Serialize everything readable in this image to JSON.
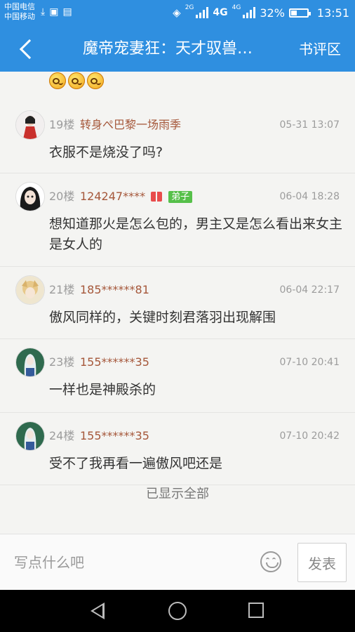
{
  "status_bar": {
    "carrier1": "中国电信",
    "carrier2": "中国移动",
    "net1": "2G",
    "net2": "4G",
    "net3": "4G",
    "battery_pct": "32%",
    "battery_fraction": 0.32,
    "time": "13:51",
    "icons": [
      "download-icon",
      "image-icon",
      "keyboard-icon",
      "vibrate-icon",
      "signal-icon",
      "battery-icon"
    ]
  },
  "header": {
    "back_icon": "chevron-left-icon",
    "title": "魔帝宠妻狂：天才驭兽…",
    "review_link": "书评区"
  },
  "comments": [
    {
      "floor": "19楼",
      "user": "转身ぺ巴黎一场雨季",
      "time": "05-31 13:07",
      "text": "衣服不是烧没了吗?"
    },
    {
      "floor": "20楼",
      "user": "124247****",
      "badge": "弟子",
      "time": "06-04 18:28",
      "text": "想知道那火是怎么包的，男主又是怎么看出来女主是女人的"
    },
    {
      "floor": "21楼",
      "user": "185******81",
      "time": "06-04 22:17",
      "text": "傲风同样的，关键时刻君落羽出现解围"
    },
    {
      "floor": "23楼",
      "user": "155******35",
      "time": "07-10 20:41",
      "text": "一样也是神殿杀的"
    },
    {
      "floor": "24楼",
      "user": "155******35",
      "time": "07-10 20:42",
      "text": "受不了我再看一遍傲风吧还是"
    }
  ],
  "footer_note": "已显示全部",
  "composer": {
    "placeholder": "写点什么吧",
    "value": "",
    "emoji_icon": "smiley-icon",
    "send_label": "发表"
  },
  "nav": {
    "back_icon": "triangle-back-icon",
    "home_icon": "circle-home-icon",
    "recent_icon": "square-recent-icon"
  },
  "colors": {
    "accent": "#2f8fe0",
    "username": "#a5573a",
    "badge": "#56c04a"
  }
}
